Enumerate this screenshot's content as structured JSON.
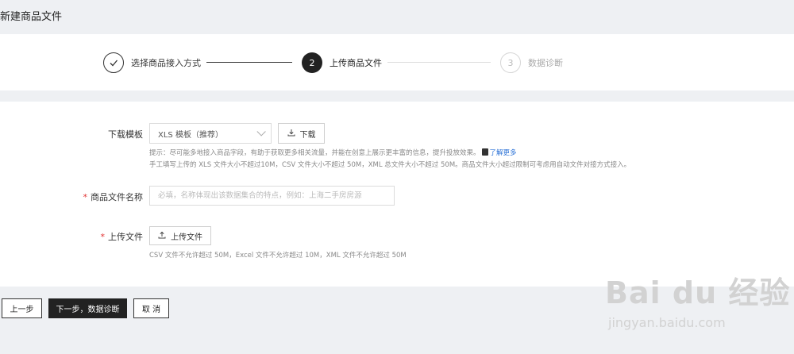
{
  "page": {
    "title": "新建商品文件"
  },
  "steps": [
    {
      "number": "",
      "label": "选择商品接入方式",
      "status": "done"
    },
    {
      "number": "2",
      "label": "上传商品文件",
      "status": "active"
    },
    {
      "number": "3",
      "label": "数据诊断",
      "status": "pending"
    }
  ],
  "template": {
    "label": "下载模板",
    "selected": "XLS 模板（推荐）",
    "download_label": "下载",
    "hint_line1": "提示：尽可能多地接入商品字段，有助于获取更多相关流量，并能在创意上展示更丰富的信息，提升投放效果。",
    "learn_more": "了解更多",
    "hint_line2": "手工填写上传的 XLS 文件大小不超过10M，CSV 文件大小不超过 50M，XML 总文件大小不超过 50M。商品文件大小超过限制可考虑用自动文件对接方式接入。"
  },
  "name_field": {
    "label": "商品文件名称",
    "placeholder": "必填，名称体现出该数据集合的特点，例如：上海二手房房源"
  },
  "upload": {
    "label": "上传文件",
    "button": "上传文件",
    "hint": "CSV 文件不允许超过 50M，Excel 文件不允许超过 10M，XML 文件不允许超过 50M"
  },
  "footer": {
    "prev": "上一步",
    "next": "下一步，数据诊断",
    "cancel": "取 消"
  },
  "watermark": {
    "main": "Bai du 经验",
    "sub": "jingyan.baidu.com"
  },
  "colors": {
    "primary": "#222222",
    "required": "#e03030",
    "link": "#2a71d6"
  }
}
